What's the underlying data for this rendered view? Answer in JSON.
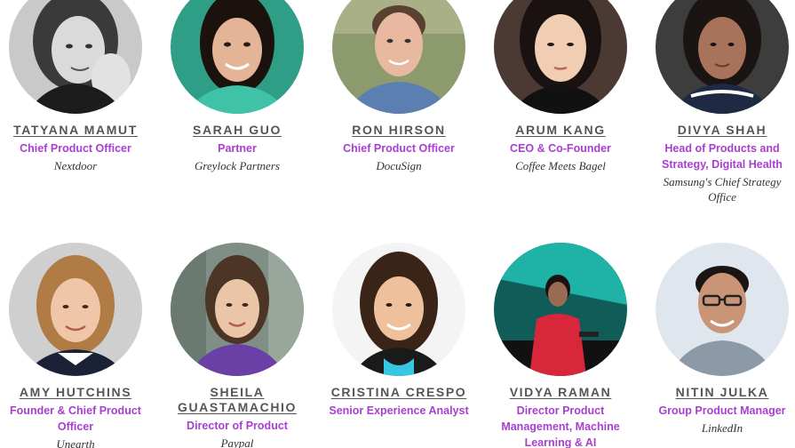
{
  "speakers": [
    {
      "name": "TATYANA MAMUT",
      "role": "Chief Product Officer",
      "company": "Nextdoor",
      "bg": "#bdbdbd",
      "skin": "#d9d9d9",
      "hair": "#3a3a3a",
      "shirt": "#1a1a1a"
    },
    {
      "name": "SARAH GUO",
      "role": "Partner",
      "company": "Greylock Partners",
      "bg": "#2f9e86",
      "skin": "#e4b497",
      "hair": "#1b120e",
      "shirt": "#40c2a6"
    },
    {
      "name": "RON HIRSON",
      "role": "Chief Product Officer",
      "company": "DocuSign",
      "bg": "#8d9a6e",
      "skin": "#e8b8a0",
      "hair": "#5a4030",
      "shirt": "#5b7fb0"
    },
    {
      "name": "ARUM KANG",
      "role": "CEO & Co-Founder",
      "company": "Coffee Meets Bagel",
      "bg": "#4a3a33",
      "skin": "#f1cdb4",
      "hair": "#1a1210",
      "shirt": "#111111"
    },
    {
      "name": "DIVYA SHAH",
      "role": "Head of Products and Strategy, Digital Health",
      "company": "Samsung's Chief Strategy Office",
      "bg": "#3d3d3d",
      "skin": "#a8735a",
      "hair": "#1a1412",
      "shirt": "#1e2a44"
    },
    {
      "name": "AMY HUTCHINS",
      "role": "Founder & Chief Product Officer",
      "company": "Unearth",
      "bg": "#cfcfcf",
      "skin": "#f0c6a8",
      "hair": "#b07b45",
      "shirt": "#1b2238"
    },
    {
      "name": "SHEILA GUASTAMACHIO",
      "role": "Director of Product",
      "company": "Paypal",
      "bg": "#7f8f86",
      "skin": "#eac5a8",
      "hair": "#4c3525",
      "shirt": "#6a3fa6"
    },
    {
      "name": "CRISTINA CRESPO",
      "role": "Senior Experience Analyst",
      "company": "",
      "bg": "#f4f4f4",
      "skin": "#efc09c",
      "hair": "#3a2418",
      "shirt": "#35c8e0"
    },
    {
      "name": "VIDYA RAMAN",
      "role": "Director Product Management, Machine Learning & AI",
      "company": "",
      "bg": "#0f5c58",
      "skin": "#9a6a52",
      "hair": "#1a1210",
      "shirt": "#d8263a"
    },
    {
      "name": "NITIN JULKA",
      "role": "Group Product Manager",
      "company": "LinkedIn",
      "bg": "#dfe6ee",
      "skin": "#c99576",
      "hair": "#1a1412",
      "shirt": "#8c9aa8"
    }
  ]
}
